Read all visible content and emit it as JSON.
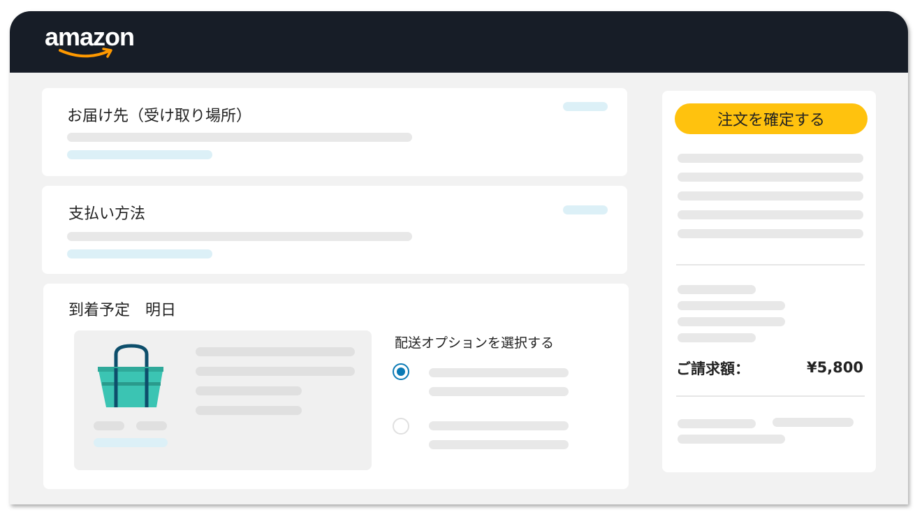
{
  "header": {
    "logo_text": "amazon"
  },
  "shipping": {
    "title": "お届け先（受け取り場所）"
  },
  "payment": {
    "title": "支払い方法"
  },
  "delivery": {
    "title": "到着予定　明日",
    "options_title": "配送オプションを選択する",
    "options": [
      {
        "selected": true
      },
      {
        "selected": false
      }
    ]
  },
  "summary": {
    "place_order_label": "注文を確定する",
    "total_label": "ご請求額：",
    "total_value": "¥5,800"
  },
  "colors": {
    "header_bg": "#171d27",
    "accent_yellow": "#ffc20e",
    "radio_blue": "#0a7ab5",
    "bag_teal": "#3bc4b3",
    "bag_handle": "#0d4e6b",
    "smile_orange": "#ff9900"
  },
  "icons": {
    "bag": "shopping-bag-icon",
    "logo_smile": "smile-arrow-icon"
  }
}
